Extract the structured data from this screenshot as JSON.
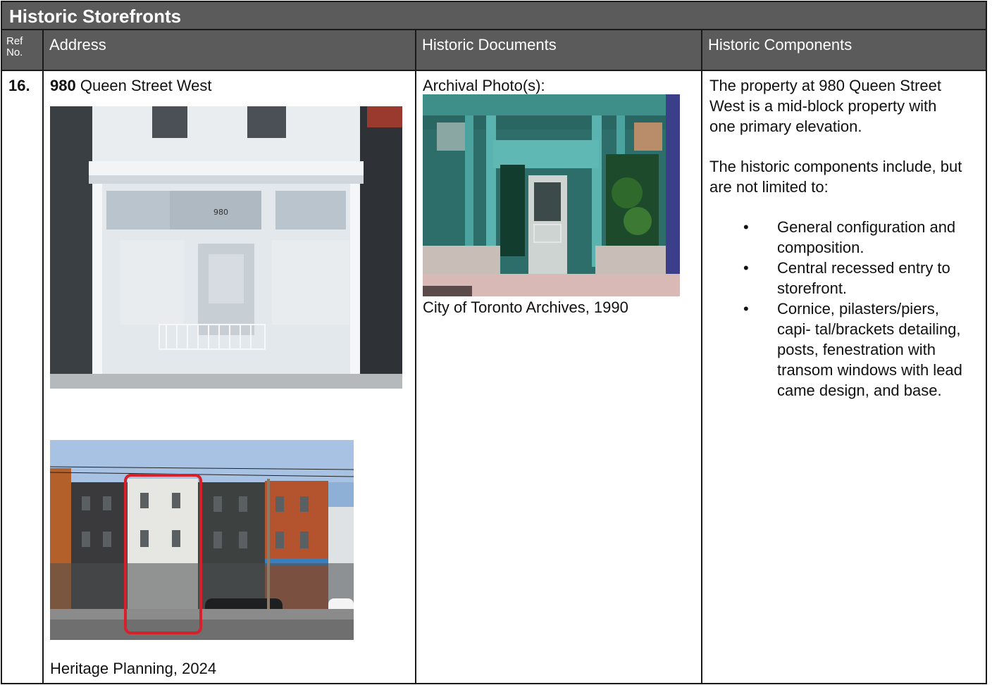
{
  "title": "Historic Storefronts",
  "headers": {
    "ref": "Ref No.",
    "address": "Address",
    "documents": "Historic Documents",
    "components": "Historic Components"
  },
  "row": {
    "ref": "16.",
    "address_number": "980",
    "address_street": "Queen Street West",
    "photo_storefront_sign": "980",
    "photo_street_credit": "Heritage Planning, 2024",
    "archival_label": "Archival Photo(s):",
    "archival_credit": "City of Toronto Archives, 1990",
    "components_intro": "The property at 980 Queen Street West is a mid-block property with one primary elevation.",
    "components_lead": "The historic components include, but are not limited to:",
    "components_items": [
      "General configuration and composition.",
      "Central recessed entry to storefront.",
      "Cornice, pilasters/piers, capi- tal/brackets detailing, posts, fenestration with transom windows with lead came design, and base."
    ]
  },
  "colors": {
    "header_bg": "#5b5b5b",
    "highlight": "#d6202a"
  }
}
